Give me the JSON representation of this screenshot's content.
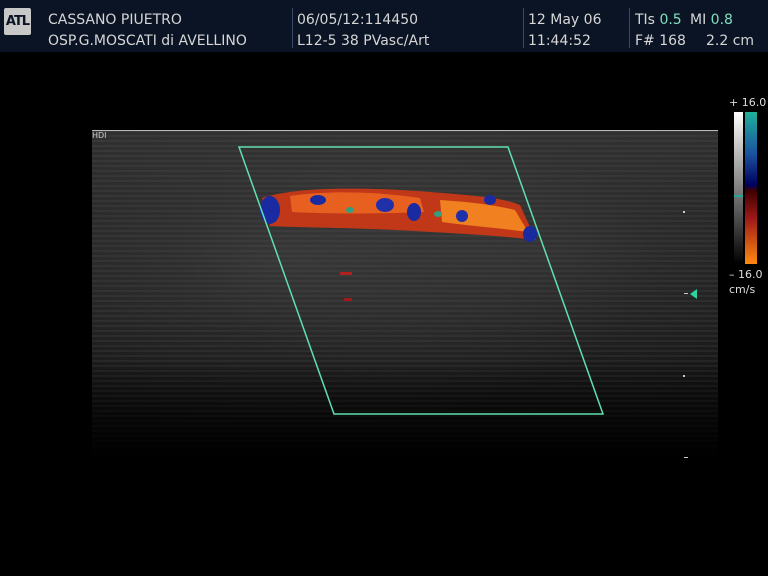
{
  "logo": "ATL",
  "patient": {
    "name": "CASSANO PIUETRO",
    "hospital": "OSP.G.MOSCATI di AVELLINO"
  },
  "exam": {
    "id": "06/05/12:114450",
    "probe": "L12-5 38 PVasc/Art"
  },
  "datetime": {
    "date": "12 May 06",
    "time": "11:44:52"
  },
  "indices": {
    "tis_label": "TIs",
    "tis_value": "0.5",
    "mi_label": "MI",
    "mi_value": "0.8",
    "frame": "F# 168",
    "depth": "2.2 cm"
  },
  "image_tag": "HDI",
  "color_scale": {
    "top": "+ 16.0",
    "bottom": "– 16.0",
    "unit": "cm/s"
  },
  "colors": {
    "roi_box": "#5fe0b0",
    "header_bg": "#0b1424",
    "highlight": "#7fe0c0"
  }
}
